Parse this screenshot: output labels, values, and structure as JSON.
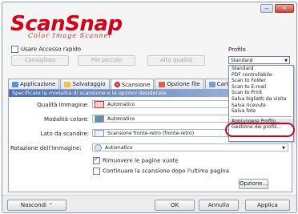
{
  "window": {
    "minimize_label": "—",
    "close_label": "✕",
    "logo_text": "ScanSnap",
    "logo_sub": "Color Image Scanner"
  },
  "top": {
    "quick_access_label": "Usare Accesso rapido",
    "buttons": [
      "Consigliato",
      "File piccolo",
      "Alta qualità"
    ],
    "profile_label": "Profilo",
    "profile_value": "Standard"
  },
  "tabs": [
    {
      "label": "Applicazione"
    },
    {
      "label": "Salvataggio"
    },
    {
      "label": "Scansione"
    },
    {
      "label": "Opzione file"
    },
    {
      "label": "Carta"
    }
  ],
  "panel": {
    "banner": "Specificare la modalità di scansione e le opzioni desiderate",
    "rows": [
      {
        "label": "Qualità immagine:",
        "value": "Automatico"
      },
      {
        "label": "Modalità colore:",
        "value": "Automatico"
      },
      {
        "label": "Lato da scandire:",
        "value": "Scansione fronte-retro (fronte-retro)"
      },
      {
        "label": "Rotazione dell'immagine:",
        "value": "Automatico"
      }
    ],
    "checkboxes": [
      {
        "label": "Rimuovere le pagine vuote",
        "checked": true
      },
      {
        "label": "Continuare la scansione dopo l'ultima pagina",
        "checked": false
      }
    ],
    "option_button": "Opzione..."
  },
  "dropdown": {
    "items": [
      "Standard",
      "PDF controllabile",
      "Scan to Folder",
      "Scan to E-mail",
      "Scan to Print",
      "Salva biglietti da visita",
      "Salva ricevute",
      "Salva foto"
    ],
    "actions": [
      "Aggiungere Profilo...",
      "Gestione dei profili..."
    ],
    "highlighted": "Aggiungere Profilo..."
  },
  "bottom": {
    "hide_label": "Nascondi",
    "ok_label": "OK",
    "cancel_label": "Annulla",
    "apply_label": "Applica"
  },
  "colors": {
    "brand": "#d0021b",
    "banner": "#4a6fb0",
    "highlight_ring": "#d0021b"
  }
}
